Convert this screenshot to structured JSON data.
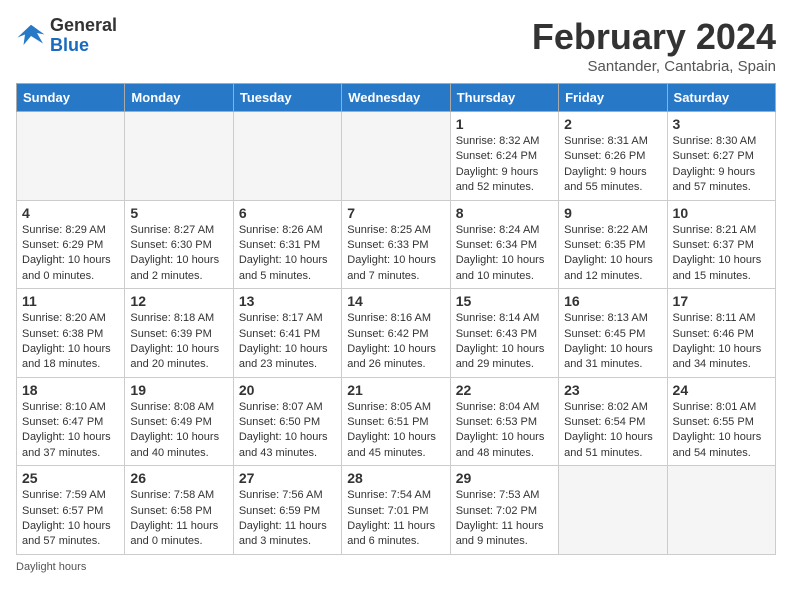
{
  "header": {
    "logo_line1": "General",
    "logo_line2": "Blue",
    "month_title": "February 2024",
    "subtitle": "Santander, Cantabria, Spain"
  },
  "days_of_week": [
    "Sunday",
    "Monday",
    "Tuesday",
    "Wednesday",
    "Thursday",
    "Friday",
    "Saturday"
  ],
  "weeks": [
    [
      {
        "day": "",
        "info": ""
      },
      {
        "day": "",
        "info": ""
      },
      {
        "day": "",
        "info": ""
      },
      {
        "day": "",
        "info": ""
      },
      {
        "day": "1",
        "info": "Sunrise: 8:32 AM\nSunset: 6:24 PM\nDaylight: 9 hours and 52 minutes."
      },
      {
        "day": "2",
        "info": "Sunrise: 8:31 AM\nSunset: 6:26 PM\nDaylight: 9 hours and 55 minutes."
      },
      {
        "day": "3",
        "info": "Sunrise: 8:30 AM\nSunset: 6:27 PM\nDaylight: 9 hours and 57 minutes."
      }
    ],
    [
      {
        "day": "4",
        "info": "Sunrise: 8:29 AM\nSunset: 6:29 PM\nDaylight: 10 hours and 0 minutes."
      },
      {
        "day": "5",
        "info": "Sunrise: 8:27 AM\nSunset: 6:30 PM\nDaylight: 10 hours and 2 minutes."
      },
      {
        "day": "6",
        "info": "Sunrise: 8:26 AM\nSunset: 6:31 PM\nDaylight: 10 hours and 5 minutes."
      },
      {
        "day": "7",
        "info": "Sunrise: 8:25 AM\nSunset: 6:33 PM\nDaylight: 10 hours and 7 minutes."
      },
      {
        "day": "8",
        "info": "Sunrise: 8:24 AM\nSunset: 6:34 PM\nDaylight: 10 hours and 10 minutes."
      },
      {
        "day": "9",
        "info": "Sunrise: 8:22 AM\nSunset: 6:35 PM\nDaylight: 10 hours and 12 minutes."
      },
      {
        "day": "10",
        "info": "Sunrise: 8:21 AM\nSunset: 6:37 PM\nDaylight: 10 hours and 15 minutes."
      }
    ],
    [
      {
        "day": "11",
        "info": "Sunrise: 8:20 AM\nSunset: 6:38 PM\nDaylight: 10 hours and 18 minutes."
      },
      {
        "day": "12",
        "info": "Sunrise: 8:18 AM\nSunset: 6:39 PM\nDaylight: 10 hours and 20 minutes."
      },
      {
        "day": "13",
        "info": "Sunrise: 8:17 AM\nSunset: 6:41 PM\nDaylight: 10 hours and 23 minutes."
      },
      {
        "day": "14",
        "info": "Sunrise: 8:16 AM\nSunset: 6:42 PM\nDaylight: 10 hours and 26 minutes."
      },
      {
        "day": "15",
        "info": "Sunrise: 8:14 AM\nSunset: 6:43 PM\nDaylight: 10 hours and 29 minutes."
      },
      {
        "day": "16",
        "info": "Sunrise: 8:13 AM\nSunset: 6:45 PM\nDaylight: 10 hours and 31 minutes."
      },
      {
        "day": "17",
        "info": "Sunrise: 8:11 AM\nSunset: 6:46 PM\nDaylight: 10 hours and 34 minutes."
      }
    ],
    [
      {
        "day": "18",
        "info": "Sunrise: 8:10 AM\nSunset: 6:47 PM\nDaylight: 10 hours and 37 minutes."
      },
      {
        "day": "19",
        "info": "Sunrise: 8:08 AM\nSunset: 6:49 PM\nDaylight: 10 hours and 40 minutes."
      },
      {
        "day": "20",
        "info": "Sunrise: 8:07 AM\nSunset: 6:50 PM\nDaylight: 10 hours and 43 minutes."
      },
      {
        "day": "21",
        "info": "Sunrise: 8:05 AM\nSunset: 6:51 PM\nDaylight: 10 hours and 45 minutes."
      },
      {
        "day": "22",
        "info": "Sunrise: 8:04 AM\nSunset: 6:53 PM\nDaylight: 10 hours and 48 minutes."
      },
      {
        "day": "23",
        "info": "Sunrise: 8:02 AM\nSunset: 6:54 PM\nDaylight: 10 hours and 51 minutes."
      },
      {
        "day": "24",
        "info": "Sunrise: 8:01 AM\nSunset: 6:55 PM\nDaylight: 10 hours and 54 minutes."
      }
    ],
    [
      {
        "day": "25",
        "info": "Sunrise: 7:59 AM\nSunset: 6:57 PM\nDaylight: 10 hours and 57 minutes."
      },
      {
        "day": "26",
        "info": "Sunrise: 7:58 AM\nSunset: 6:58 PM\nDaylight: 11 hours and 0 minutes."
      },
      {
        "day": "27",
        "info": "Sunrise: 7:56 AM\nSunset: 6:59 PM\nDaylight: 11 hours and 3 minutes."
      },
      {
        "day": "28",
        "info": "Sunrise: 7:54 AM\nSunset: 7:01 PM\nDaylight: 11 hours and 6 minutes."
      },
      {
        "day": "29",
        "info": "Sunrise: 7:53 AM\nSunset: 7:02 PM\nDaylight: 11 hours and 9 minutes."
      },
      {
        "day": "",
        "info": ""
      },
      {
        "day": "",
        "info": ""
      }
    ]
  ],
  "footer": {
    "daylight_hours_label": "Daylight hours"
  }
}
